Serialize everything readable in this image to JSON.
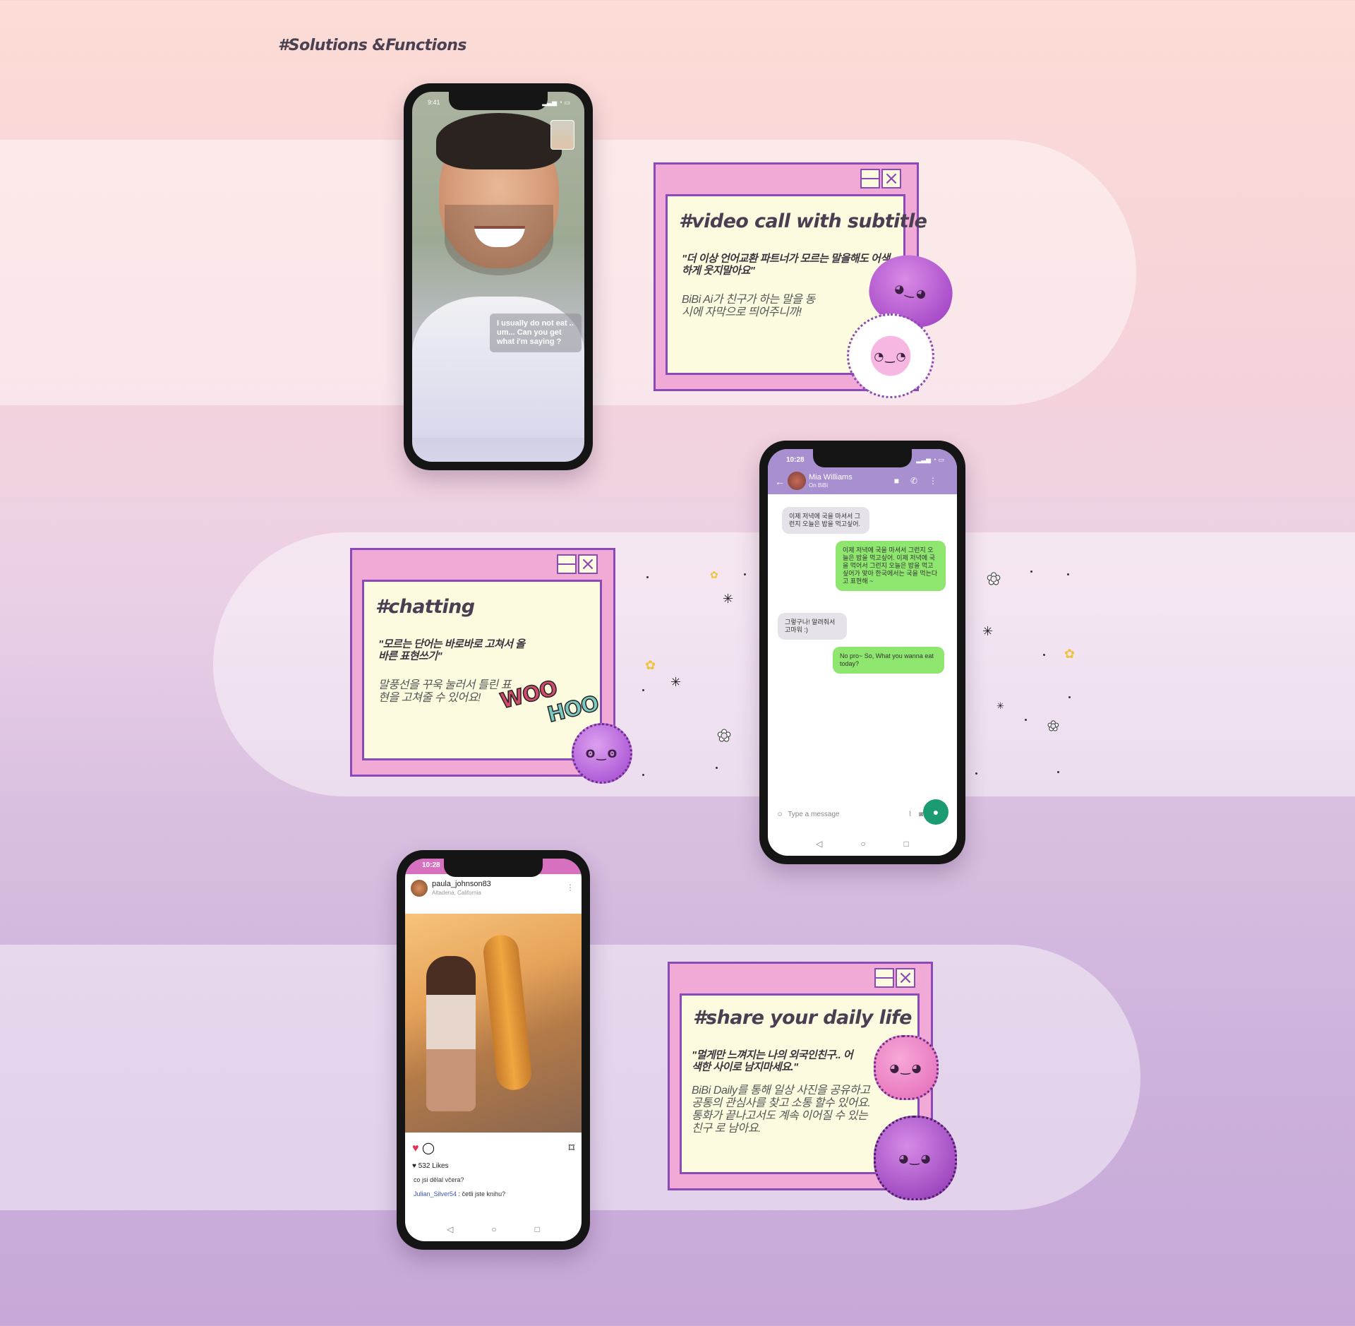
{
  "page": {
    "heading": "#Solutions &Functions"
  },
  "video_call": {
    "status_time": "9:41",
    "status_icons": "▂▃▅ ◔ ▭",
    "subtitle": "I usually do not eat .. um... Can you get what i'm saying ?",
    "card": {
      "title": "#video call with subtitle",
      "quote": "\"더 이상 언어교환 파트너가 모르는 말을해도 어색하게 웃지말아요\"",
      "desc": "BiBi Ai가 친구가 하는 말을 동시에 자막으로 띄어주니까!"
    }
  },
  "chat": {
    "status_time": "10:28",
    "status_icons": "▂▃▅ ◔ ▭",
    "contact_name": "Mia Williams",
    "contact_sub": "On BiBi",
    "messages": [
      {
        "dir": "in",
        "text": "이제 저녁에 국을 마셔서 그런지 오늘은 밥을 먹고싶어."
      },
      {
        "dir": "out",
        "text": "이제 저녁에 국을 마셔서 그런지 오늘은 밥을 먹고싶어. 이제 저녁에 국을 먹어서 그런지 오늘은 밥을 먹고싶어가 맞아 한국에서는 국을 먹는다고 표현해 ~"
      },
      {
        "dir": "in",
        "text": "그렇구나! 알려줘서 고마워 :)"
      },
      {
        "dir": "out",
        "text": "No pro~ So, What you wanna eat today?"
      }
    ],
    "input_placeholder": "Type a message",
    "card": {
      "title": "#chatting",
      "quote": "\"모르는 단어는 바로바로 고쳐서 올바른 표현쓰기\"",
      "desc": "말풍선을 꾸욱 눌러서 틀린 표현을 고쳐줄 수 있어요!"
    },
    "sticker_text": [
      "WOO",
      "HOO"
    ]
  },
  "feed": {
    "status_time": "10:28",
    "username": "paula_johnson83",
    "location": "Altadena, California",
    "likes": "532 Likes",
    "caption": "co jsi dělal včera?",
    "comment_user": "Julian_Silver54",
    "comment_text": " : četli jste knihu?",
    "card": {
      "title": "#share your daily life",
      "quote": "\"멀게만 느껴지는 나의 외국인친구.. 어색한 사이로 남지마세요.\"",
      "desc": "BiBi Daily를 통해 일상 사진을 공유하고 공통의 관심사를 찾고 소통 할수 있어요. 통화가 끝나고서도 계속 이어질 수 있는 친구 로 남아요."
    }
  },
  "colors": {
    "card_bg": "#f1a9d6",
    "card_inner": "#fdfbdf",
    "card_border": "#8a4bb6",
    "chat_header": "#a78fd0",
    "out_bubble": "#8ee66f",
    "mic": "#1a9b72"
  }
}
